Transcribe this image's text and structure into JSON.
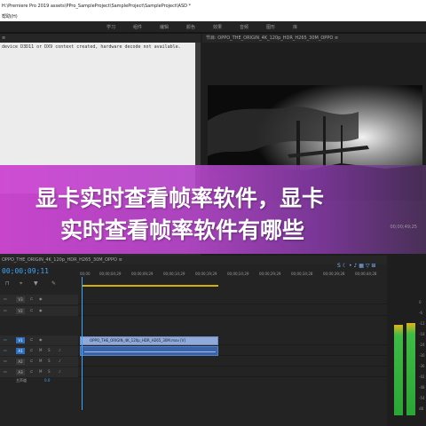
{
  "window": {
    "title": "H:\\Premiere Pro 2019 assets\\PPro_SampleProject\\SampleProject\\SampleProject\\ASD *"
  },
  "menu": [
    "帮助(H)"
  ],
  "workspace": {
    "tabs": [
      "学习",
      "组件",
      "编辑",
      "颜色",
      "效果",
      "音频",
      "图形",
      "库"
    ]
  },
  "source_panel": {
    "tab_label": "",
    "message": "device D3D11 or DX9 context created, hardware decode not available."
  },
  "program_monitor": {
    "tab_label": "节目: OPPO_THE_ORIGIN_4K_120p_HDR_H265_30M_OPPO ≡",
    "timecode": "00;00;49;25"
  },
  "overlay": {
    "line1": "显卡实时查看帧率软件，显卡",
    "line2": "实时查看帧率软件有哪些"
  },
  "timeline": {
    "sequence_tab": "OPPO_THE_ORIGIN_4K_120p_HDR_H265_30M_OPPO ≡",
    "playhead_timecode": "00;00;09;11",
    "ruler": [
      "00;00",
      "00;00;04;29",
      "00;00;09;29",
      "00;00;14;29",
      "00;00;19;29",
      "00;00;24;29",
      "00;00;29;29",
      "00;00;34;28",
      "00;00;39;28",
      "00;00;44;28"
    ],
    "tracks": [
      {
        "id": "V3",
        "type": "video",
        "selected": false
      },
      {
        "id": "V2",
        "type": "video",
        "selected": false
      },
      {
        "id": "V1",
        "type": "video",
        "selected": true
      },
      {
        "id": "A1",
        "type": "audio",
        "selected": true
      },
      {
        "id": "A2",
        "type": "audio",
        "selected": false
      },
      {
        "id": "A3",
        "type": "audio",
        "selected": false
      }
    ],
    "video_clip_label": "OPPO_THE_ORIGIN_4K_120p_HDR_H265_30M.mov [V]",
    "master_label": "主声道",
    "master_value": "0.0"
  },
  "audio_meter": {
    "scale": [
      "0",
      "-6",
      "-12",
      "-18",
      "-24",
      "-30",
      "-36",
      "-42",
      "-48",
      "-54",
      "dB"
    ],
    "left_level": 0.82,
    "right_level": 0.84
  },
  "colors": {
    "accent_blue": "#3da5f4",
    "work_area_yellow": "#d4b106",
    "banner_pink": "#cd46d2"
  }
}
